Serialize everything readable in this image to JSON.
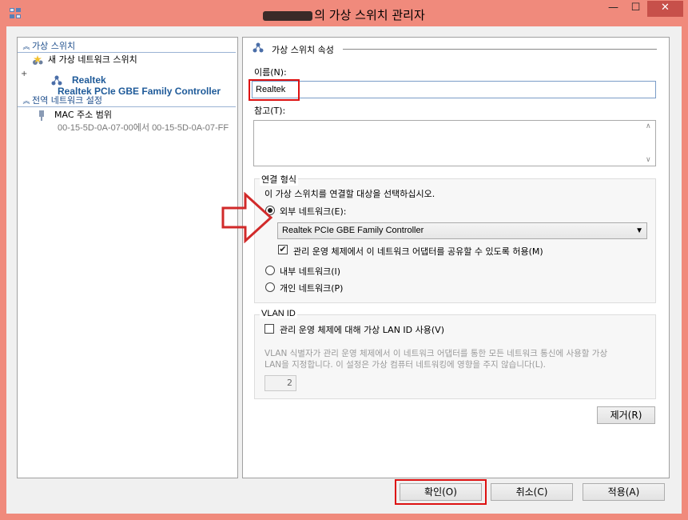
{
  "window": {
    "title": "의 가상 스위치 관리자",
    "minimize_glyph": "—",
    "maximize_glyph": "☐",
    "close_glyph": "✕"
  },
  "sidebar": {
    "section_virtual_switches": "가상 스위치",
    "new_switch": "새 가상 네트워크 스위치",
    "expander": "+",
    "switch_name": "Realtek",
    "switch_adapter": "Realtek PCIe GBE Family Controller",
    "section_global": "전역 네트워크 설정",
    "mac_range_label": "MAC 주소 범위",
    "mac_range_value": "00-15-5D-0A-07-00에서 00-15-5D-0A-07-FF"
  },
  "properties": {
    "group_title": "가상 스위치 속성",
    "name_label": "이름(N):",
    "name_value": "Realtek",
    "notes_label": "참고(T):",
    "connection_type_title": "연결 형식",
    "connection_type_prompt": "이 가상 스위치를 연결할 대상을 선택하십시오.",
    "external_label": "외부 네트워크(E):",
    "adapter_selected": "Realtek PCIe GBE Family Controller",
    "allow_mgmt_label": "관리 운영 체제에서 이 네트워크 어댑터를 공유할 수 있도록 허용(M)",
    "internal_label": "내부 네트워크(I)",
    "private_label": "개인 네트워크(P)",
    "vlan_title": "VLAN ID",
    "vlan_checkbox_label": "관리 운영 체제에 대해 가상 LAN ID 사용(V)",
    "vlan_help_line1": "VLAN 식별자가 관리 운영 체제에서 이 네트워크 어댑터를 통한 모든 네트워크 통신에 사용할 가상",
    "vlan_help_line2": "LAN을 지정합니다. 이 설정은 가상 컴퓨터 네트워킹에 영향을 주지 않습니다(L).",
    "vlan_id_value": "2",
    "remove_button": "제거(R)"
  },
  "footer": {
    "ok_button": "확인(O)",
    "cancel_button": "취소(C)",
    "apply_button": "적용(A)"
  },
  "state": {
    "external_selected": true,
    "allow_mgmt_checked": true,
    "vlan_checked": false
  },
  "colors": {
    "window_frame": "#f08a7c",
    "close_button": "#c7504a",
    "link_blue": "#1e5a99",
    "highlight_red": "#dd1111"
  }
}
